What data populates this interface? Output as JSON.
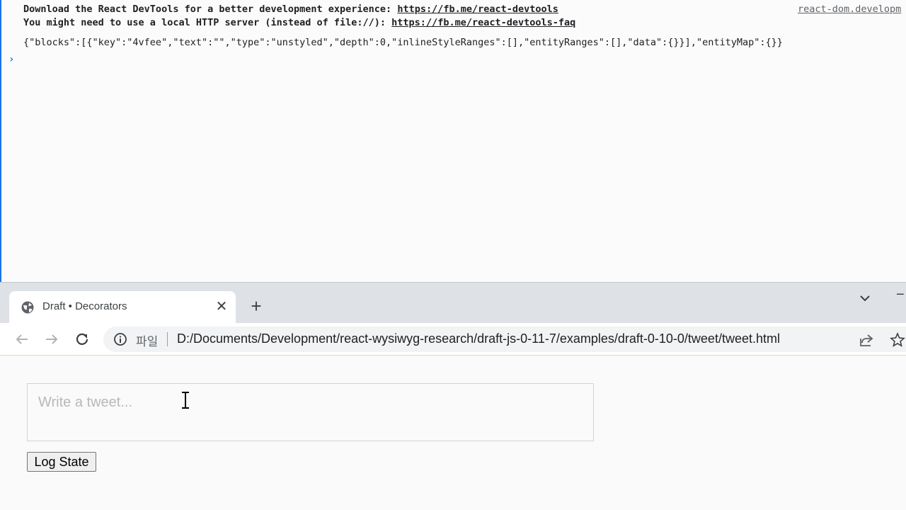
{
  "console": {
    "line1_text": "Download the React DevTools for a better development experience: ",
    "line1_link": "https://fb.me/react-devtools",
    "line2_text": "You might need to use a local HTTP server (instead of file://): ",
    "line2_link": "https://fb.me/react-devtools-faq",
    "source_link": "react-dom.developm",
    "log_output": "{\"blocks\":[{\"key\":\"4vfee\",\"text\":\"\",\"type\":\"unstyled\",\"depth\":0,\"inlineStyleRanges\":[],\"entityRanges\":[],\"data\":{}}],\"entityMap\":{}}",
    "prompt_caret": "›"
  },
  "browser": {
    "tab_title": "Draft • Decorators",
    "tab_close": "✕",
    "new_tab": "+",
    "win_ctrl": "−",
    "scheme_label": "파일",
    "url": "D:/Documents/Development/react-wysiwyg-research/draft-js-0-11-7/examples/draft-0-10-0/tweet/tweet.html"
  },
  "page": {
    "editor_placeholder": "Write a tweet...",
    "log_button": "Log State"
  },
  "icons": {
    "tab_favicon": "globe-icon",
    "back": "arrow-left-icon",
    "forward": "arrow-right-icon",
    "reload": "reload-icon",
    "info": "info-icon",
    "share": "share-icon",
    "bookmark": "star-icon",
    "tab_list": "chevron-down-icon",
    "cursor": "i-beam-cursor-icon"
  },
  "colors": {
    "accent": "#1a73e8",
    "tabstrip": "#dee1e6",
    "placeholder": "#b8b8b8"
  }
}
